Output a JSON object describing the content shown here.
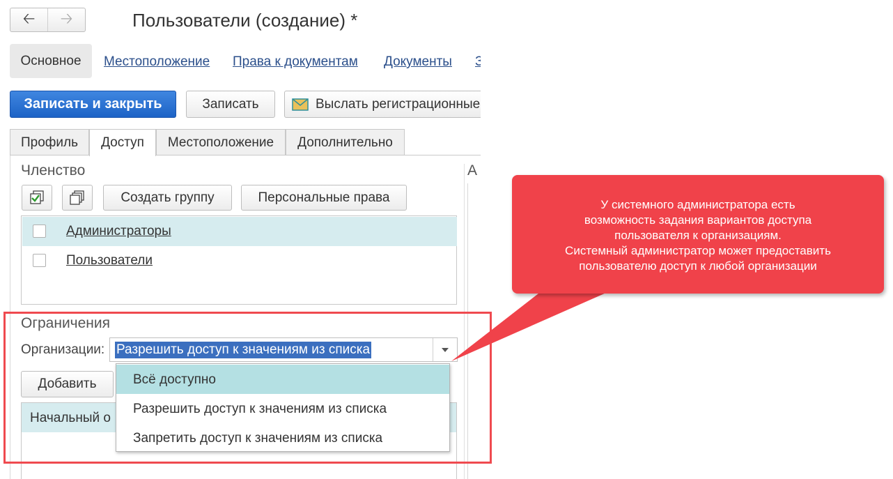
{
  "window": {
    "title": "Пользователи (создание) *"
  },
  "sections": {
    "active": "Основное",
    "links": [
      "Местоположение",
      "Права к документам",
      "Документы",
      "З"
    ]
  },
  "toolbar": {
    "save_close": "Записать и закрыть",
    "save": "Записать",
    "send": "Выслать регистрационные"
  },
  "tabs": [
    "Профиль",
    "Доступ",
    "Местоположение",
    "Дополнительно"
  ],
  "membership": {
    "heading": "Членство",
    "create_group": "Создать группу",
    "personal_rights": "Персональные права",
    "groups": [
      {
        "label": "Администраторы",
        "checked": false
      },
      {
        "label": "Пользователи",
        "checked": false
      }
    ]
  },
  "right_panel": {
    "heading_fragment": "А"
  },
  "restrictions": {
    "heading": "Ограничения",
    "organizations_label": "Организации:",
    "organizations_value": "Разрешить доступ к значениям из списка",
    "add_button": "Добавить",
    "grid_first_row": "Начальный о"
  },
  "dropdown": {
    "options": [
      "Всё доступно",
      "Разрешить доступ к значениям из списка",
      "Запретить доступ к значениям из списка"
    ],
    "highlighted_index": 0
  },
  "callout": {
    "text": "У системного администратора есть\nвозможность задания вариантов доступа\nпользователя к организациям.\nСистемный администратор может предоставить\nпользователю доступ к любой организации"
  },
  "colors": {
    "primary": "#1d63c6",
    "callout": "#f0424a",
    "highlight_row": "#d6ecef",
    "dropdown_highlight": "#b4e0e3",
    "selection": "#3b6fbf"
  }
}
